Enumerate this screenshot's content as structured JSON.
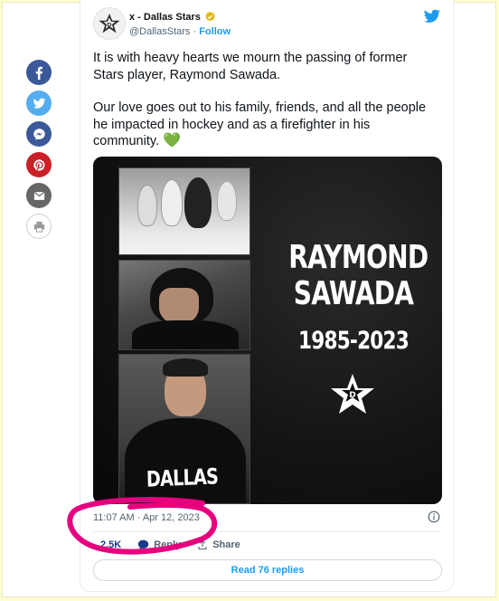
{
  "share_rail": {
    "items": [
      {
        "name": "facebook",
        "color": "#3b5998",
        "icon": "facebook-icon"
      },
      {
        "name": "twitter",
        "color": "#55acee",
        "icon": "twitter-icon"
      },
      {
        "name": "messenger",
        "color": "#3b5998",
        "icon": "messenger-icon"
      },
      {
        "name": "pinterest",
        "color": "#cb2027",
        "icon": "pinterest-icon"
      },
      {
        "name": "email",
        "color": "#666666",
        "icon": "email-icon"
      },
      {
        "name": "print",
        "color": "#ffffff",
        "icon": "print-icon"
      }
    ]
  },
  "tweet": {
    "display_name": "x - Dallas Stars",
    "handle": "@DallasStars",
    "separator": " · ",
    "follow_label": "Follow",
    "paragraph_1": "It is with heavy hearts we mourn the passing of former Stars player, Raymond Sawada.",
    "paragraph_2": "Our love goes out to his family, friends, and all the people he impacted in hockey and as a firefighter in his community.",
    "heart_emoji": "💚",
    "media": {
      "memorial_name": "RAYMOND SAWADA",
      "memorial_years": "1985-2023",
      "jersey_text": "DALLAS"
    },
    "timestamp": "11:07 AM · Apr 12, 2023",
    "likes_count": "2.5K",
    "reply_label": "Reply",
    "share_label": "Share",
    "read_replies_label": "Read 76 replies"
  },
  "colors": {
    "twitter_blue": "#1d9bf0",
    "verified_gold": "#e2b719",
    "annotation_pink": "#e6007e",
    "page_background": "#fefed0"
  }
}
